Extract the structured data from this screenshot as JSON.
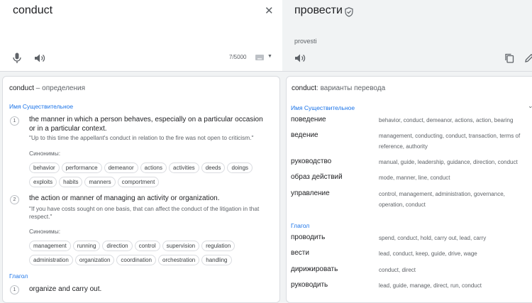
{
  "source": {
    "text": "conduct",
    "char_count": "7/5000"
  },
  "target": {
    "text": "провести",
    "transliteration": "provesti"
  },
  "definitions": {
    "title_word": "conduct",
    "title_rest": " – определения",
    "noun_label": "Имя Существительное",
    "verb_label": "Глагол",
    "synonyms_label": "Синонимы:",
    "items": [
      {
        "num": "1",
        "text": "the manner in which a person behaves, especially on a particular occasion or in a particular context.",
        "example": "\"Up to this time the appellant's conduct in relation to the fire was not open to criticism.\"",
        "synonyms_row1": [
          "behavior",
          "performance",
          "demeanor",
          "actions",
          "activities",
          "deeds",
          "doings"
        ],
        "synonyms_row2": [
          "exploits",
          "habits",
          "manners",
          "comportment"
        ]
      },
      {
        "num": "2",
        "text": "the action or manner of managing an activity or organization.",
        "example": "\"If you have costs sought on one basis, that can affect the conduct of the litigation in that respect.\"",
        "synonyms_row1": [
          "management",
          "running",
          "direction",
          "control",
          "supervision",
          "regulation"
        ],
        "synonyms_row2": [
          "administration",
          "organization",
          "coordination",
          "orchestration",
          "handling"
        ]
      },
      {
        "num": "1",
        "text": "organize and carry out."
      }
    ]
  },
  "translations": {
    "title_word": "conduct",
    "title_rest": ": варианты перевода",
    "noun_label": "Имя Существительное",
    "verb_label": "Глагол",
    "noun_rows": [
      {
        "word": "поведение",
        "back": "behavior, conduct, demeanor, actions, action, bearing"
      },
      {
        "word": "ведение",
        "back": "management, conducting, conduct, transaction, terms of reference, authority"
      },
      {
        "word": "руководство",
        "back": "manual, guide, leadership, guidance, direction, conduct"
      },
      {
        "word": "образ действий",
        "back": "mode, manner, line, conduct"
      },
      {
        "word": "управление",
        "back": "control, management, administration, governance, operation, conduct"
      }
    ],
    "verb_rows": [
      {
        "word": "проводить",
        "back": "spend, conduct, hold, carry out, lead, carry"
      },
      {
        "word": "вести",
        "back": "lead, conduct, keep, guide, drive, wage"
      },
      {
        "word": "дирижировать",
        "back": "conduct, direct"
      },
      {
        "word": "руководить",
        "back": "lead, guide, manage, direct, run, conduct"
      }
    ]
  },
  "icons": {
    "clear": "close-icon",
    "mic": "microphone-icon",
    "speaker": "speaker-icon",
    "keyboard": "keyboard-icon",
    "verified": "shield-check-icon",
    "copy": "copy-icon",
    "edit": "edit-icon"
  },
  "colors": {
    "accent": "#1a73e8",
    "muted": "#5f6368"
  }
}
